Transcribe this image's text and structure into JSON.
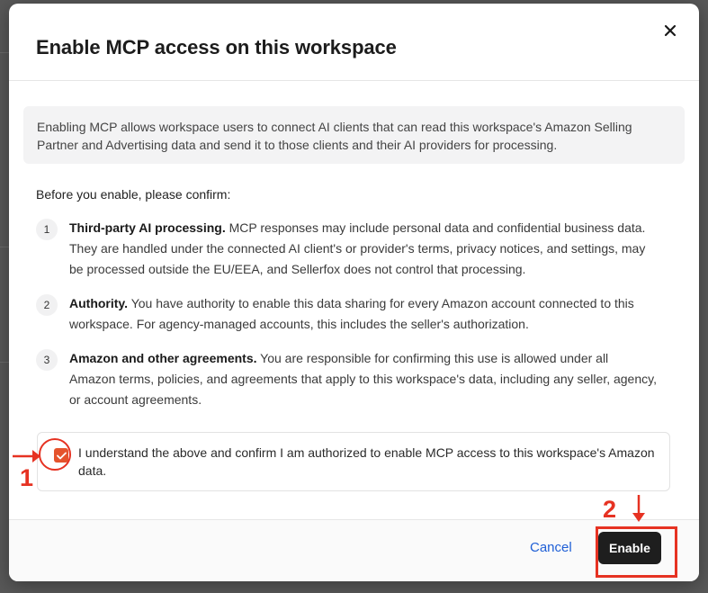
{
  "modal": {
    "title": "Enable MCP access on this workspace",
    "close_icon": "close-icon"
  },
  "info": {
    "text": "Enabling MCP allows workspace users to connect AI clients that can read this workspace's Amazon Selling Partner and Advertising data and send it to those clients and their AI providers for processing."
  },
  "confirm_intro": "Before you enable, please confirm:",
  "terms": [
    {
      "number": "1",
      "title": "Third-party AI processing.",
      "body": " MCP responses may include personal data and confidential business data. They are handled under the connected AI client's or provider's terms, privacy notices, and settings, may be processed outside the EU/EEA, and Sellerfox does not control that processing."
    },
    {
      "number": "2",
      "title": "Authority.",
      "body": " You have authority to enable this data sharing for every Amazon account connected to this workspace. For agency-managed accounts, this includes the seller's authorization."
    },
    {
      "number": "3",
      "title": "Amazon and other agreements.",
      "body": " You are responsible for confirming this use is allowed under all Amazon terms, policies, and agreements that apply to this workspace's data, including any seller, agency, or account agreements."
    }
  ],
  "acknowledgement": {
    "checked": true,
    "label": "I understand the above and confirm I am authorized to enable MCP access to this workspace's Amazon data."
  },
  "footer": {
    "cancel_label": "Cancel",
    "enable_label": "Enable"
  },
  "annotations": {
    "step_1": "1",
    "step_2": "2",
    "color": "#e63222"
  },
  "colors": {
    "accent": "#e5532c",
    "link": "#1f5fd6",
    "primary_button": "#1e1e1e"
  }
}
